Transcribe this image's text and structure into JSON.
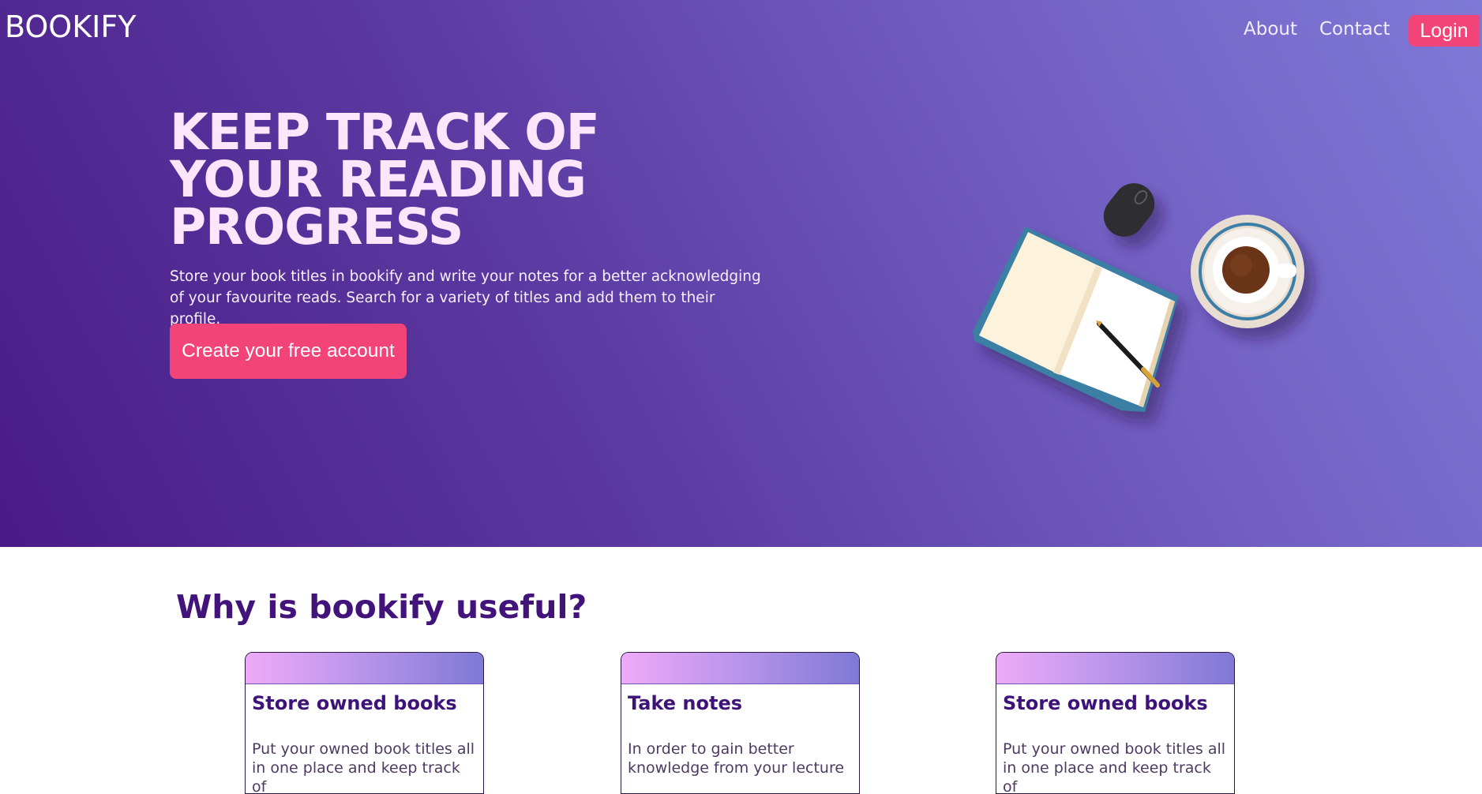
{
  "header": {
    "brand": "BOOKIFY",
    "nav": {
      "about": "About",
      "contact": "Contact",
      "login": "Login"
    }
  },
  "hero": {
    "headline_lines": [
      "KEEP TRACK OF",
      "YOUR READING",
      "PROGRESS"
    ],
    "subtext": "Store your book titles in bookify and write your notes for a better acknowledging of your favourite reads. Search for a variety of titles and add them to their profile.",
    "cta_label": "Create your free account",
    "illustration_icons": [
      "open-book-icon",
      "pen-icon",
      "mouse-icon",
      "coffee-cup-icon"
    ]
  },
  "features": {
    "title": "Why is bookify useful?",
    "cards": [
      {
        "title": "Store owned books",
        "text": "Put your owned book titles all in one place and keep track of"
      },
      {
        "title": "Take notes",
        "text": "In order to gain better knowledge from your lecture"
      },
      {
        "title": "Store owned books",
        "text": "Put your owned book titles all in one place and keep track of"
      }
    ]
  },
  "colors": {
    "accent": "#f24478",
    "hero_gradient_start": "#4a1a86",
    "hero_gradient_end": "#7f79d6",
    "heading_purple": "#42137a",
    "headline_pink": "#fde6fb"
  }
}
